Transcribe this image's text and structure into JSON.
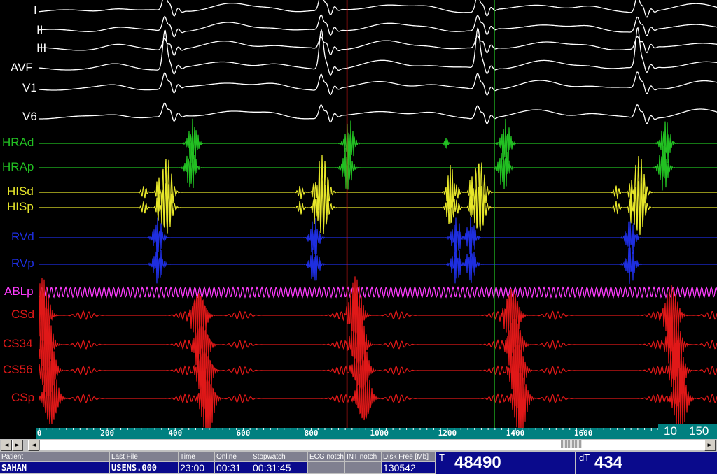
{
  "colors": {
    "surface": "#ffffff",
    "hra": "#22c022",
    "his": "#e6e62a",
    "rv": "#1e2ee0",
    "abl": "#ff3cff",
    "cs": "#e01818",
    "marker_red": "#e01818",
    "marker_green": "#22c022"
  },
  "channels": [
    {
      "label": "I",
      "group": "surface"
    },
    {
      "label": "II",
      "group": "surface"
    },
    {
      "label": "III",
      "group": "surface"
    },
    {
      "label": "AVF",
      "group": "surface"
    },
    {
      "label": "V1",
      "group": "surface"
    },
    {
      "label": "V6",
      "group": "surface"
    },
    {
      "label": "HRAd",
      "group": "hra"
    },
    {
      "label": "HRAp",
      "group": "hra"
    },
    {
      "label": "HISd",
      "group": "his"
    },
    {
      "label": "HISp",
      "group": "his"
    },
    {
      "label": "RVd",
      "group": "rv"
    },
    {
      "label": "RVp",
      "group": "rv"
    },
    {
      "label": "ABLp",
      "group": "abl"
    },
    {
      "label": "CSd",
      "group": "cs"
    },
    {
      "label": "CS34",
      "group": "cs"
    },
    {
      "label": "CS56",
      "group": "cs"
    },
    {
      "label": "CSp",
      "group": "cs"
    }
  ],
  "time_axis": {
    "min_ms": 0,
    "max_ms": 1820,
    "ticks": [
      "0",
      "200",
      "400",
      "600",
      "800",
      "1000",
      "1200",
      "1400",
      "1600"
    ]
  },
  "beats_ms": [
    370,
    830,
    1290,
    1760
  ],
  "premature_his_ms": 1210,
  "markers_ms": [
    {
      "name": "cursor-red",
      "t": 905,
      "color": "red"
    },
    {
      "name": "cursor-green",
      "t": 1338,
      "color": "green"
    }
  ],
  "speed": {
    "gain": "10",
    "rate": "150"
  },
  "scroll": {
    "left_arrow": "◄",
    "right_arrow": "►",
    "position_fraction": 0.81
  },
  "status": {
    "patient": {
      "label": "Patient",
      "value": "SAHAN"
    },
    "last_file": {
      "label": "Last File",
      "value": "USENS.000"
    },
    "time": {
      "label": "Time",
      "value": "23:00"
    },
    "online": {
      "label": "Online",
      "value": "00:31"
    },
    "stopwatch": {
      "label": "Stopwatch",
      "value": "00:31:45"
    },
    "ecg_notch": {
      "label": "ECG notch",
      "value": ""
    },
    "int_notch": {
      "label": "INT notch",
      "value": ""
    },
    "disk_free": {
      "label": "Disk Free [Mb]",
      "value": "130542"
    }
  },
  "readout": {
    "t_label": "T",
    "t_value": "48490",
    "dt_label": "dT",
    "dt_value": "434"
  }
}
